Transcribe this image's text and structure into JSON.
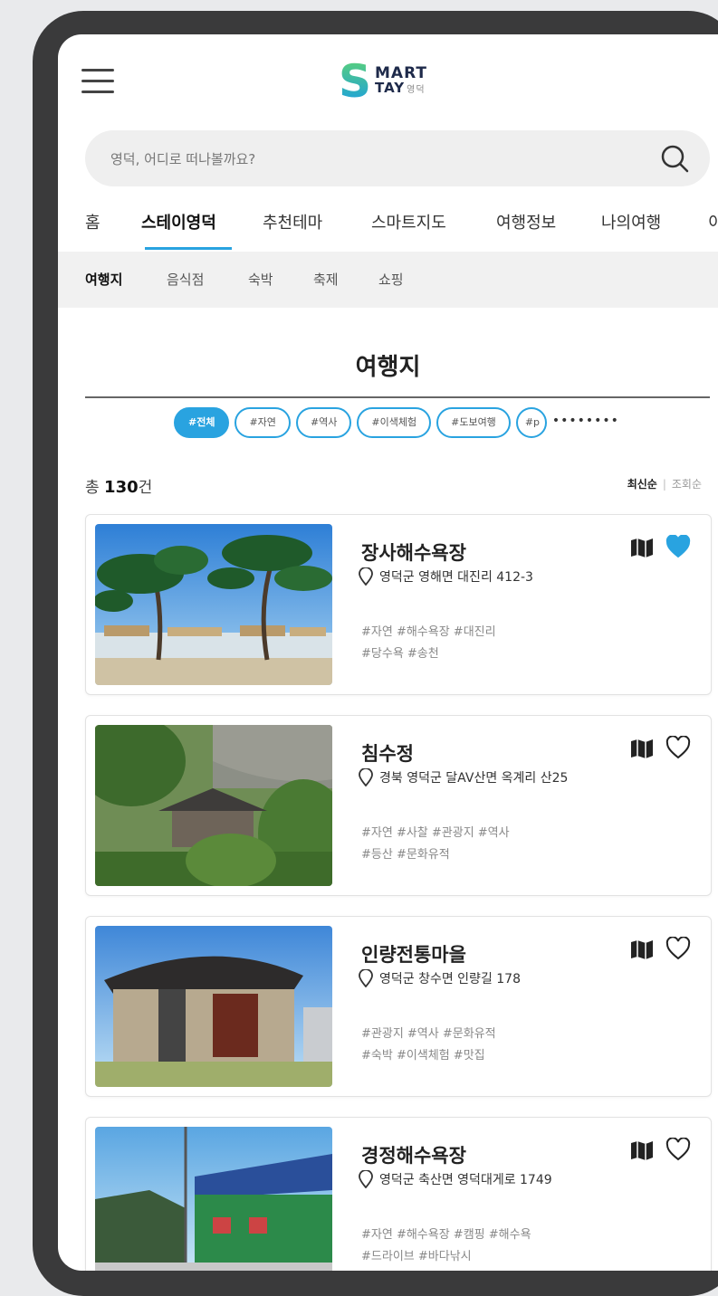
{
  "logo": {
    "letter": "S",
    "line1": "MART",
    "line2": "TAY",
    "region": "영덕"
  },
  "search": {
    "placeholder": "영덕, 어디로 떠나볼까요?"
  },
  "nav": {
    "tabs": [
      "홈",
      "스테이영덕",
      "추천테마",
      "스마트지도",
      "여행정보",
      "나의여행",
      "이"
    ],
    "active": "스테이영덕"
  },
  "subnav": {
    "tabs": [
      "여행지",
      "음식점",
      "숙박",
      "축제",
      "쇼핑"
    ],
    "active": "여행지"
  },
  "page": {
    "title": "여행지"
  },
  "chips": [
    "#전체",
    "#자연",
    "#역사",
    "#이색체험",
    "#도보여행",
    "#p"
  ],
  "chips_more": "••••••••",
  "summary": {
    "prefix": "총",
    "count": "130",
    "suffix": "건"
  },
  "sort": {
    "latest": "최신순",
    "separator": "|",
    "views": "조회순"
  },
  "places": [
    {
      "name": "장사해수욕장",
      "address": "영덕군 영해면 대진리 412-3",
      "tags_line1": "#자연 #해수욕장 #대진리",
      "tags_line2": "#당수욕 #송천",
      "liked": true
    },
    {
      "name": "침수정",
      "address": "경북 영덕군 달AV산면 옥계리 산25",
      "tags_line1": "#자연 #사찰 #관광지 #역사",
      "tags_line2": "#등산 #문화유적",
      "liked": false
    },
    {
      "name": "인량전통마을",
      "address": "영덕군 창수면 인량길 178",
      "tags_line1": "#관광지 #역사 #문화유적",
      "tags_line2": "#숙박 #이색체험 #맛집",
      "liked": false
    },
    {
      "name": "경정해수욕장",
      "address": "영덕군 축산면 영덕대게로 1749",
      "tags_line1": "#자연 #해수욕장 #캠핑 #해수욕",
      "tags_line2": "#드라이브 #바다낚시",
      "liked": false
    }
  ],
  "colors": {
    "accent": "#29a3e0",
    "heart_filled": "#29a3e0"
  },
  "icons": [
    "menu-icon",
    "search-icon",
    "location-pin-icon",
    "map-icon",
    "heart-icon"
  ]
}
